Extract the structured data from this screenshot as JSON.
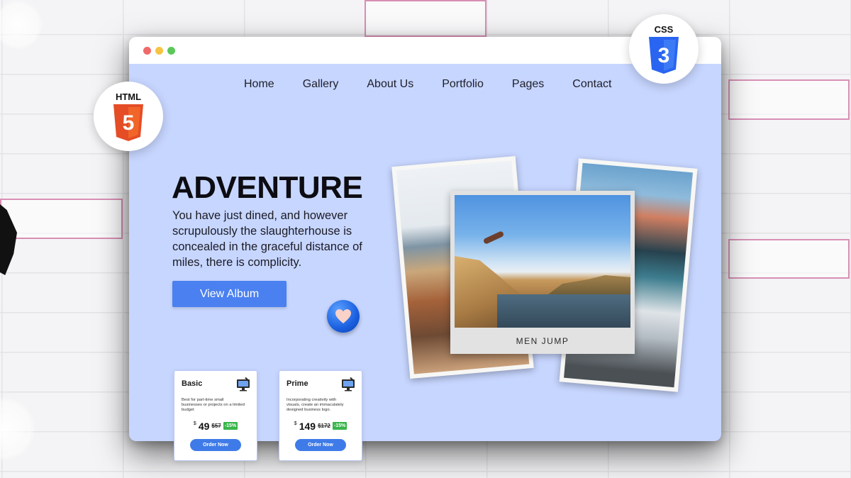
{
  "browser": {
    "dots": [
      "#f06a6a",
      "#f5c444",
      "#5cc85a"
    ]
  },
  "nav": {
    "items": [
      {
        "label": "Home"
      },
      {
        "label": "Gallery"
      },
      {
        "label": "About Us"
      },
      {
        "label": "Portfolio"
      },
      {
        "label": "Pages"
      },
      {
        "label": "Contact"
      }
    ]
  },
  "hero": {
    "title": "ADVENTURE",
    "text": "You have just dined, and however scrupulously the slaughterhouse is concealed in the graceful distance of miles, there is complicity.",
    "button_label": "View Album",
    "badge_icon": "heart-icon"
  },
  "gallery": {
    "center_caption": "MEN JUMP"
  },
  "pricing": [
    {
      "name": "Basic",
      "icon": "design-monitor-icon",
      "description": "Best for part-time small businesses or projects on a limited budget",
      "currency": "$",
      "price": "49",
      "old_price": "$57",
      "discount": "-15%",
      "button_label": "Order Now"
    },
    {
      "name": "Prime",
      "icon": "design-monitor-icon",
      "description": "Incorporating creativity with visuals, create an immaculately designed business logo.",
      "currency": "$",
      "price": "149",
      "old_price": "$172",
      "discount": "-15%",
      "button_label": "Order Now"
    }
  ],
  "badges": {
    "html_label": "HTML",
    "html_number": "5",
    "css_label": "CSS",
    "css_number": "3"
  },
  "colors": {
    "page_bg": "#c7d6ff",
    "accent": "#4a80f0",
    "html_orange": "#e44d26",
    "css_blue": "#2965f1",
    "discount_green": "#38b54a"
  }
}
